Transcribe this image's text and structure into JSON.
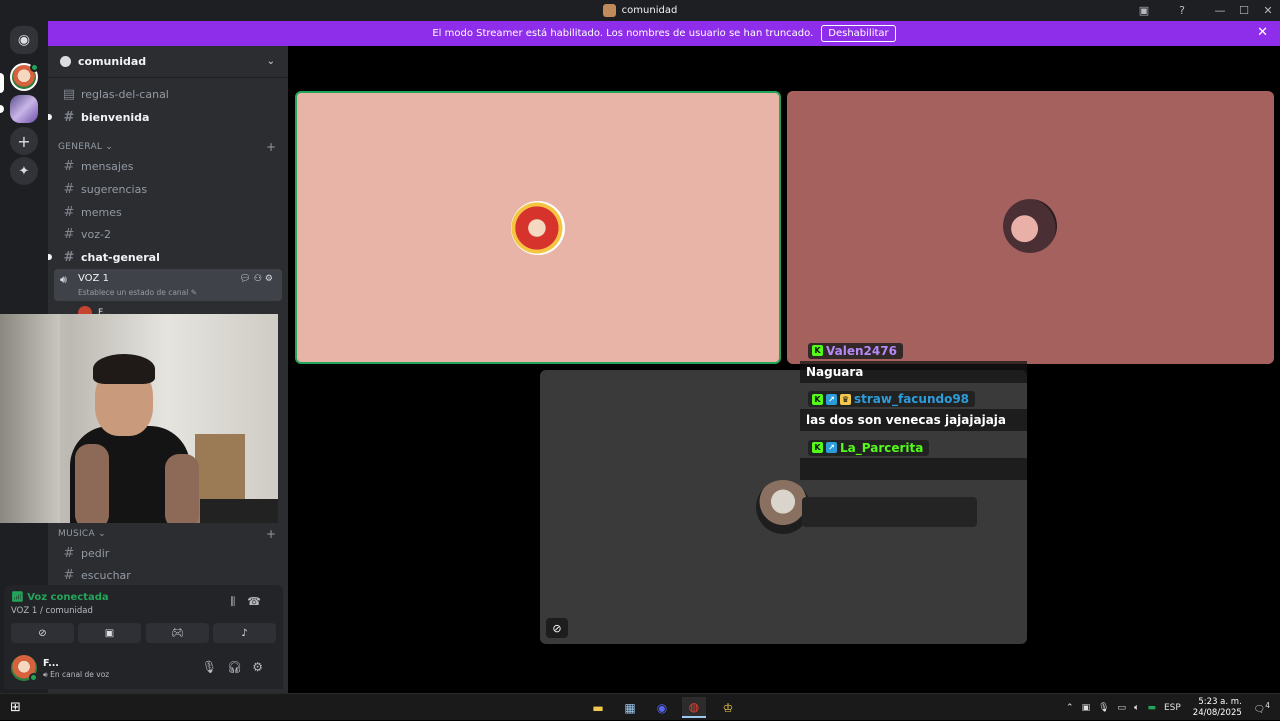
{
  "window": {
    "title": "comunidad"
  },
  "banner": {
    "text": "El modo Streamer está habilitado. Los nombres de usuario se han truncado.",
    "button_label": "Deshabilitar",
    "close_glyph": "✕"
  },
  "sidebar": {
    "server_name": "comunidad",
    "channels_top": [
      {
        "name": "reglas-del-canal",
        "icon": "rules-icon"
      },
      {
        "name": "bienvenida",
        "icon": "hash-icon",
        "unread": true
      }
    ],
    "category_general": "GENERAL",
    "channels_general": [
      {
        "name": "mensajes"
      },
      {
        "name": "sugerencias"
      },
      {
        "name": "memes"
      },
      {
        "name": "voz-2"
      },
      {
        "name": "chat-general",
        "unread": true
      }
    ],
    "voice_channel": {
      "name": "VOZ 1",
      "status_placeholder": "Establece un estado de canal",
      "member_name": "F..."
    },
    "category_musica": "MUSICA",
    "channels_musica": [
      {
        "name": "pedir"
      },
      {
        "name": "escuchar"
      }
    ]
  },
  "voice_panel": {
    "status": "Voz conectada",
    "location": "VOZ 1 / comunidad"
  },
  "user_panel": {
    "username": "F...",
    "status": "En canal de voz"
  },
  "chat_overlay": {
    "messages": [
      {
        "user": "Valen2476",
        "color": "#b589f5",
        "badges": [
          "k"
        ],
        "text": "Naguara"
      },
      {
        "user": "straw_facundo98",
        "color": "#2d9cdb",
        "badges": [
          "k",
          "bl",
          "cr"
        ],
        "text": "las dos son venecas jajajajaja"
      },
      {
        "user": "La_Parcerita",
        "color": "#53fc18",
        "badges": [
          "k",
          "bl"
        ],
        "text": ""
      }
    ]
  },
  "taskbar": {
    "language": "ESP",
    "time": "5:23 a. m.",
    "date": "24/08/2025",
    "notifications": "4"
  },
  "colors": {
    "banner": "#8f2eea",
    "speaking_border": "#23a559",
    "tile1_bg": "#e8b4a7",
    "tile2_bg": "#a5615e",
    "tile3_bg": "#3a3a3b"
  }
}
